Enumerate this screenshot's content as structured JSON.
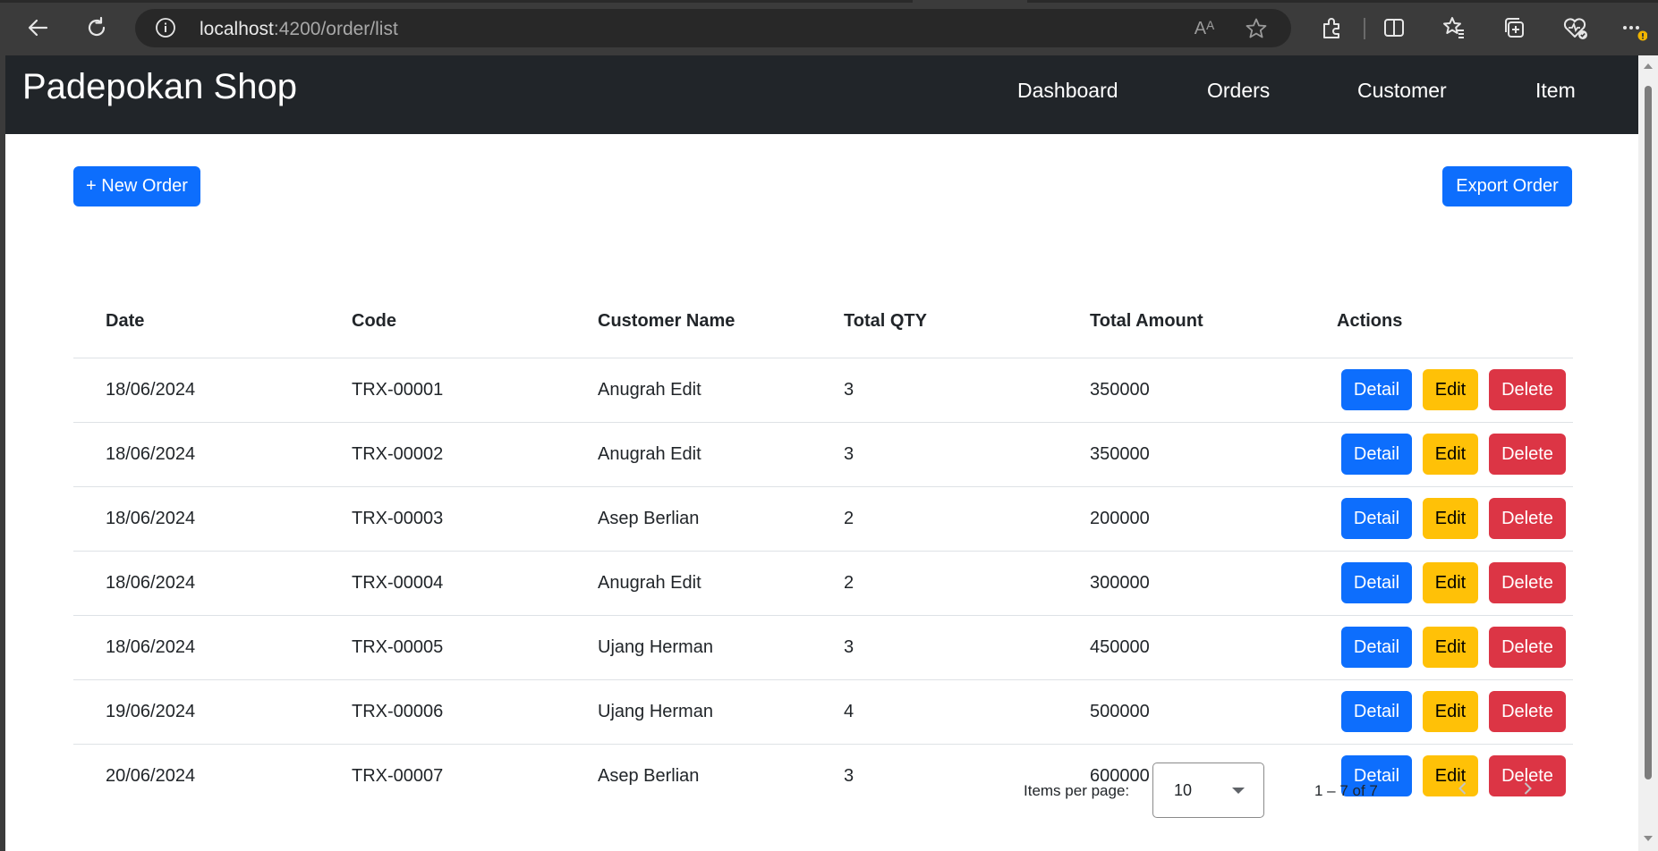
{
  "browser": {
    "url_host": "localhost",
    "url_rest": ":4200/order/list",
    "icons": [
      "back-icon",
      "refresh-icon",
      "site-info-icon",
      "read-aloud-icon",
      "favorite-star-icon",
      "extensions-icon",
      "split-screen-icon",
      "favorites-icon",
      "collections-icon",
      "browser-essentials-icon",
      "more-icon"
    ],
    "read_aloud_glyph": "Aᴬ"
  },
  "navbar": {
    "brand": "Padepokan Shop",
    "links": [
      {
        "label": "Dashboard"
      },
      {
        "label": "Orders"
      },
      {
        "label": "Customer"
      },
      {
        "label": "Item"
      }
    ],
    "background": "#212529"
  },
  "toolbar": {
    "new_order_label": "+ New Order",
    "export_order_label": "Export Order"
  },
  "table": {
    "headers": [
      "Date",
      "Code",
      "Customer Name",
      "Total QTY",
      "Total Amount",
      "Actions"
    ],
    "action_labels": {
      "detail": "Detail",
      "edit": "Edit",
      "delete": "Delete"
    },
    "rows": [
      {
        "date": "18/06/2024",
        "code": "TRX-00001",
        "customer": "Anugrah Edit",
        "qty": "3",
        "amount": "350000"
      },
      {
        "date": "18/06/2024",
        "code": "TRX-00002",
        "customer": "Anugrah Edit",
        "qty": "3",
        "amount": "350000"
      },
      {
        "date": "18/06/2024",
        "code": "TRX-00003",
        "customer": "Asep Berlian",
        "qty": "2",
        "amount": "200000"
      },
      {
        "date": "18/06/2024",
        "code": "TRX-00004",
        "customer": "Anugrah Edit",
        "qty": "2",
        "amount": "300000"
      },
      {
        "date": "18/06/2024",
        "code": "TRX-00005",
        "customer": "Ujang Herman",
        "qty": "3",
        "amount": "450000"
      },
      {
        "date": "19/06/2024",
        "code": "TRX-00006",
        "customer": "Ujang Herman",
        "qty": "4",
        "amount": "500000"
      },
      {
        "date": "20/06/2024",
        "code": "TRX-00007",
        "customer": "Asep Berlian",
        "qty": "3",
        "amount": "600000"
      }
    ]
  },
  "paginator": {
    "items_per_page_label": "Items per page:",
    "page_size": "10",
    "range_label": "1 – 7 of 7"
  },
  "colors": {
    "primary": "#0d6efd",
    "warning": "#ffc107",
    "danger": "#dc3545"
  }
}
